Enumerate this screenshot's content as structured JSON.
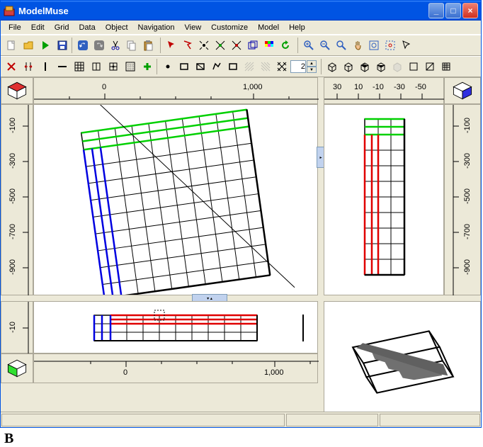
{
  "window": {
    "title": "ModelMuse"
  },
  "menu": [
    "File",
    "Edit",
    "Grid",
    "Data",
    "Object",
    "Navigation",
    "View",
    "Customize",
    "Model",
    "Help"
  ],
  "toolbar1": {
    "new": "new",
    "open": "open",
    "run": "run",
    "save": "save",
    "undo": "undo",
    "redo": "redo",
    "cut": "cut",
    "copy": "copy",
    "paste": "paste",
    "select": "select",
    "lasso": "lasso",
    "point": "point",
    "poly1": "poly1",
    "poly2": "poly2",
    "shape": "shape",
    "color": "color",
    "refresh": "refresh",
    "zoom-in": "zoom-in",
    "zoom-out": "zoom-out",
    "zoom": "zoom",
    "pan": "pan",
    "zoom-ext": "zoom-ext",
    "zoom-win": "zoom-win",
    "arrow": "arrow"
  },
  "toolbar2": {
    "del-col": "del-col",
    "move-col": "move-col",
    "single-col": "single-col",
    "line": "line",
    "grid-add": "grid-add",
    "sq1": "sq1",
    "sq2": "sq2",
    "grid2": "grid2",
    "plus": "plus",
    "pt": "pt",
    "rect": "rect",
    "rect2": "rect2",
    "poly": "poly",
    "rect3": "rect3",
    "hatch1": "hatch1",
    "hatch2": "hatch2",
    "hatch3": "hatch3",
    "layer_value": "2",
    "view1": "view1",
    "view2": "view2",
    "view3": "view3",
    "view4": "view4",
    "view5": "view5",
    "view6": "view6",
    "view7": "view7",
    "view8": "view8"
  },
  "rulers": {
    "top_main": [
      "0",
      "1,000"
    ],
    "top_side": [
      "30",
      "10",
      "-10",
      "-30",
      "-50"
    ],
    "left_main": [
      "-100",
      "-300",
      "-500",
      "-700",
      "-900"
    ],
    "right_main": [
      "-100",
      "-300",
      "-500",
      "-700",
      "-900"
    ],
    "left_bottom": [
      "-10"
    ],
    "bottom_main": [
      "0",
      "1,000"
    ]
  },
  "figure_label": "B"
}
